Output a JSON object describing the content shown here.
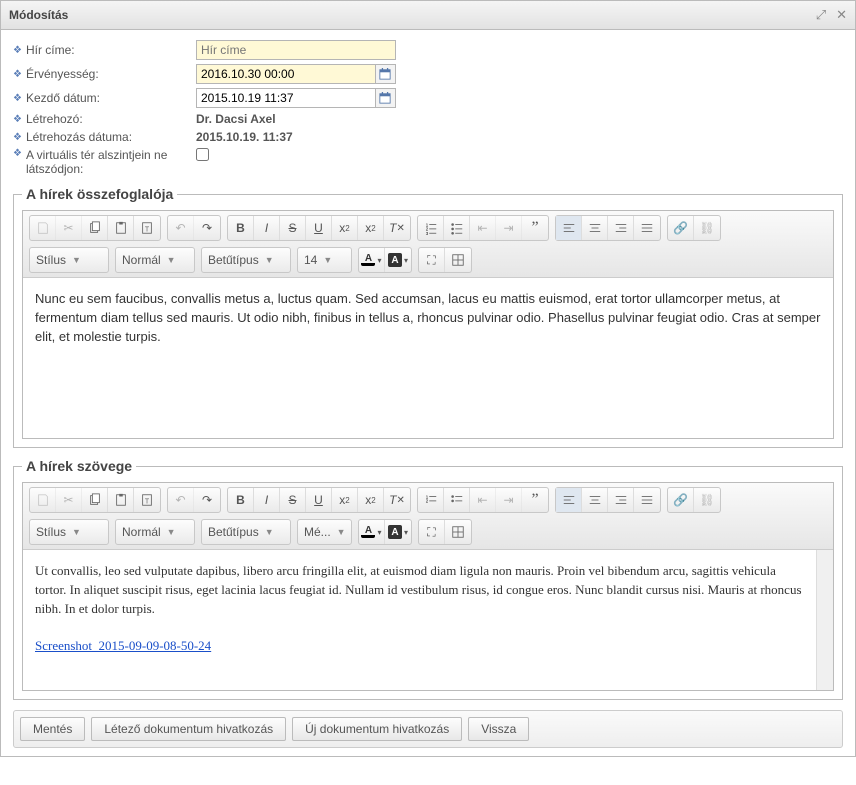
{
  "window": {
    "title": "Módosítás"
  },
  "form": {
    "title_label": "Hír címe:",
    "title_placeholder": "Hír címe",
    "validity_label": "Érvényesség:",
    "validity_value": "2016.10.30 00:00",
    "start_label": "Kezdő dátum:",
    "start_value": "2015.10.19 11:37",
    "creator_label": "Létrehozó:",
    "creator_value": "Dr. Dacsi Axel",
    "created_label": "Létrehozás dátuma:",
    "created_value": "2015.10.19. 11:37",
    "virtual_label": "A virtuális tér alszintjein ne látszódjon:"
  },
  "sections": {
    "summary_legend": "A hírek összefoglalója",
    "body_legend": "A hírek szövege"
  },
  "toolbar": {
    "style": "Stílus",
    "format": "Normál",
    "font": "Betűtípus",
    "size1": "14",
    "size2": "Mé...",
    "bold": "B",
    "italic": "I",
    "strike": "S",
    "underline": "U"
  },
  "summary_text": "Nunc eu sem faucibus, convallis metus a, luctus quam. Sed accumsan, lacus eu mattis euismod, erat tortor ullamcorper metus, at fermentum diam tellus sed mauris. Ut odio nibh, finibus in tellus a, rhoncus pulvinar odio. Phasellus pulvinar feugiat odio. Cras at semper elit, et molestie turpis.",
  "body_text": "Ut convallis, leo sed vulputate dapibus, libero arcu fringilla elit, at euismod diam ligula non mauris. Proin vel bibendum arcu, sagittis vehicula tortor. In aliquet suscipit risus, eget lacinia lacus feugiat id. Nullam id vestibulum risus, id congue eros. Nunc blandit cursus nisi. Mauris at rhoncus nibh. In et dolor turpis.",
  "body_link": "Screenshot_2015-09-09-08-50-24",
  "footer": {
    "save": "Mentés",
    "existing_doc": "Létező dokumentum hivatkozás",
    "new_doc": "Új dokumentum hivatkozás",
    "back": "Vissza"
  }
}
